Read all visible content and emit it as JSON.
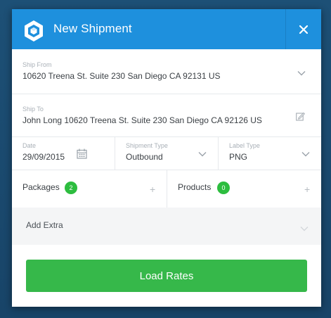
{
  "header": {
    "title": "New Shipment",
    "icons": {
      "logo": "hexagon-cube-logo",
      "close": "close-icon"
    },
    "color": "#1e90dd"
  },
  "ship_from": {
    "label": "Ship From",
    "value": "10620 Treena St. Suite 230 San Diego CA 92131 US"
  },
  "ship_to": {
    "label": "Ship To",
    "value": "John Long 10620 Treena St. Suite 230 San Diego CA 92126 US"
  },
  "date": {
    "label": "Date",
    "value": "29/09/2015"
  },
  "shipment_type": {
    "label": "Shipment Type",
    "value": "Outbound"
  },
  "label_type": {
    "label": "Label Type",
    "value": "PNG"
  },
  "packages": {
    "label": "Packages",
    "count": "2"
  },
  "products": {
    "label": "Products",
    "count": "0"
  },
  "add_extra": {
    "label": "Add Extra"
  },
  "load_rates": {
    "label": "Load Rates",
    "color": "#36b84a"
  }
}
